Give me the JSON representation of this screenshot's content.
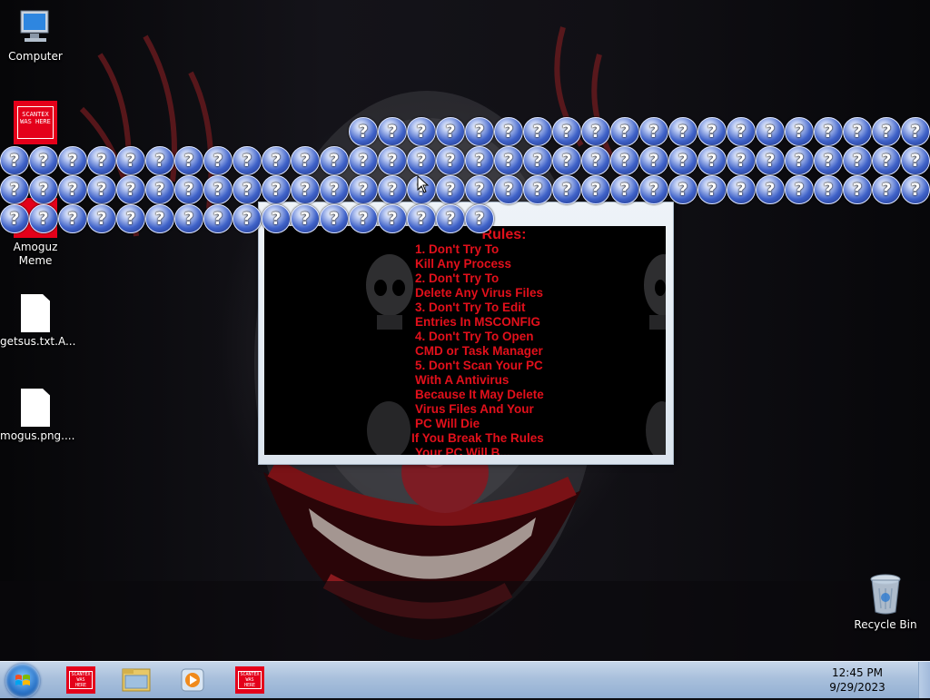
{
  "desktop": {
    "icons": {
      "computer": "Computer",
      "amogus_label_line1": "Amoguz",
      "amogus_label_line2": "Meme",
      "getsus": "getsus.txt.A...",
      "mogus": "mogus.png....",
      "recycle": "Recycle Bin"
    },
    "tile_text": "SCANTEX WAS HERE"
  },
  "question_mark": "?",
  "rules": {
    "title": "Rules:",
    "lines": [
      "1. Don't Try To",
      "Kill Any Process",
      "2. Don't Try To",
      "Delete Any Virus Files",
      "3. Don't Try To Edit",
      "Entries In MSCONFIG",
      "4. Don't Try To Open",
      "CMD or Task Manager",
      "5. Don't Scan Your PC",
      "With A Antivirus",
      "Because It May Delete",
      "Virus Files And Your",
      "PC Will Die",
      "If You Break The Rules",
      "Your PC Will B..."
    ]
  },
  "taskbar": {
    "time": "12:45 PM",
    "date": "9/29/2023"
  },
  "colors": {
    "rules_text": "#e2101b",
    "tile_red": "#e4001a",
    "taskbar": "#a9c0dc"
  }
}
